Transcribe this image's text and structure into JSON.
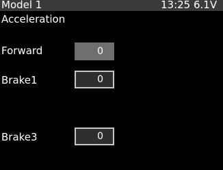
{
  "status_bar": {
    "model_name": "Model 1",
    "time_voltage": "13:25 6.1V"
  },
  "screen": {
    "title": "Acceleration"
  },
  "settings": [
    {
      "label": "Forward",
      "value": "0",
      "selected": true
    },
    {
      "label": "Brake1",
      "value": "0",
      "selected": false
    },
    {
      "label": "Brake3",
      "value": "0",
      "selected": false
    }
  ],
  "colors": {
    "status_bar_bg": "#3a3a3a",
    "selected_box_bg": "#6e6e6e",
    "box_bg": "#2e2e2e",
    "box_border": "#c8c8c8"
  }
}
